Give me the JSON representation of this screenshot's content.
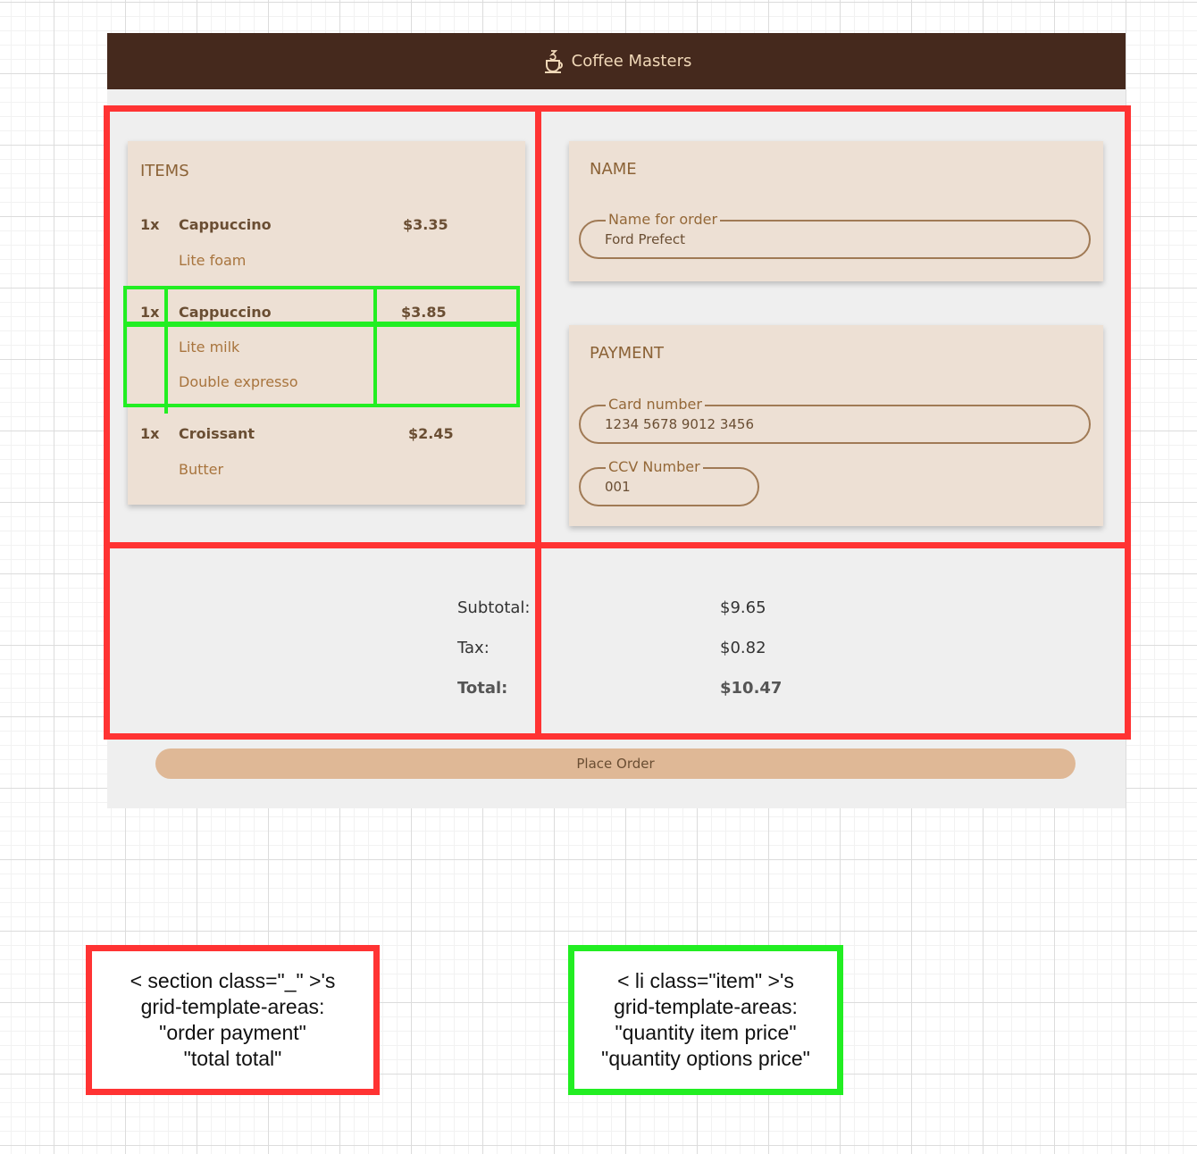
{
  "app": {
    "title": "Coffee Masters",
    "logo_icon": "coffee-cup-icon"
  },
  "items": {
    "title": "ITEMS",
    "list": [
      {
        "quantity": "1x",
        "name": "Cappuccino",
        "price": "$3.35",
        "options": [
          "Lite foam"
        ]
      },
      {
        "quantity": "1x",
        "name": "Cappuccino",
        "price": "$3.85",
        "options": [
          "Lite milk",
          "Double expresso"
        ]
      },
      {
        "quantity": "1x",
        "name": "Croissant",
        "price": "$2.45",
        "options": [
          "Butter"
        ]
      }
    ]
  },
  "name": {
    "title": "NAME",
    "field_label": "Name for order",
    "field_value": "Ford Prefect"
  },
  "payment": {
    "title": "PAYMENT",
    "card_label": "Card number",
    "card_value": "1234 5678 9012 3456",
    "ccv_label": "CCV Number",
    "ccv_value": "001"
  },
  "totals": {
    "subtotal_label": "Subtotal:",
    "subtotal_value": "$9.65",
    "tax_label": "Tax:",
    "tax_value": "$0.82",
    "total_label": "Total:",
    "total_value": "$10.47"
  },
  "actions": {
    "place_order": "Place Order"
  },
  "annotations": {
    "section_legend": [
      "< section class=\"_\" >'s",
      "grid-template-areas:",
      "\"order payment\"",
      "\"total total\""
    ],
    "item_legend": [
      "< li class=\"item\" >'s",
      "grid-template-areas:",
      "\"quantity item price\"",
      "\"quantity options price\""
    ],
    "colors": {
      "section_outline": "#ff3333",
      "item_outline": "#22ee22",
      "header": "#45291d",
      "card": "#ede0d4",
      "button": "#dfb896"
    }
  }
}
